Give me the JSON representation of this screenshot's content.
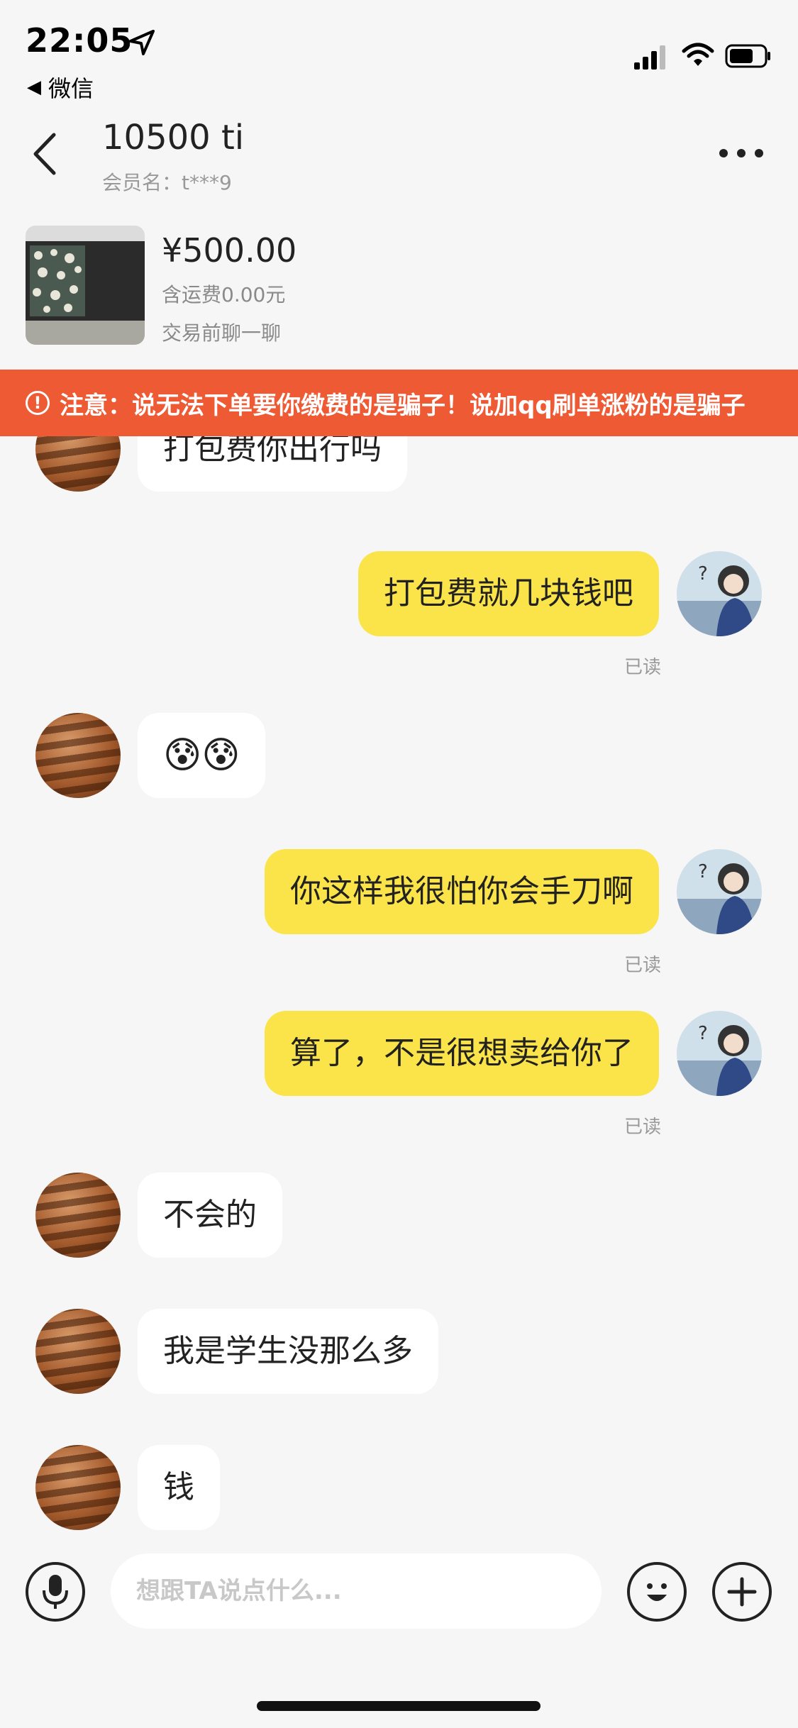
{
  "status_bar": {
    "time": "22:05",
    "back_app": "微信"
  },
  "header": {
    "title": "10500 ti",
    "member": "会员名：t***9"
  },
  "product": {
    "price": "¥500.00",
    "shipping": "含运费0.00元",
    "chat_first": "交易前聊一聊"
  },
  "banner": {
    "text": "注意：说无法下单要你缴费的是骗子！说加qq刷单涨粉的是骗子"
  },
  "messages": [
    {
      "side": "left",
      "text": "打包费你出行吗"
    },
    {
      "side": "right",
      "text": "打包费就几块钱吧",
      "status": "已读"
    },
    {
      "side": "left",
      "text": "😰😰"
    },
    {
      "side": "right",
      "text": "你这样我很怕你会手刀啊",
      "status": "已读"
    },
    {
      "side": "right",
      "text": "算了，不是很想卖给你了",
      "status": "已读"
    },
    {
      "side": "left",
      "text": "不会的"
    },
    {
      "side": "left",
      "text": "我是学生没那么多"
    },
    {
      "side": "left",
      "text": "钱"
    }
  ],
  "input": {
    "placeholder": "想跟TA说点什么..."
  },
  "icons": [
    "location-arrow-icon",
    "signal-icon",
    "wifi-icon",
    "battery-icon",
    "back-chevron-icon",
    "more-icon",
    "alert-icon",
    "mic-icon",
    "emoji-icon",
    "plus-icon"
  ],
  "colors": {
    "banner": "#ee5a34",
    "my_bubble": "#fbe44a",
    "background": "#f6f6f6"
  }
}
